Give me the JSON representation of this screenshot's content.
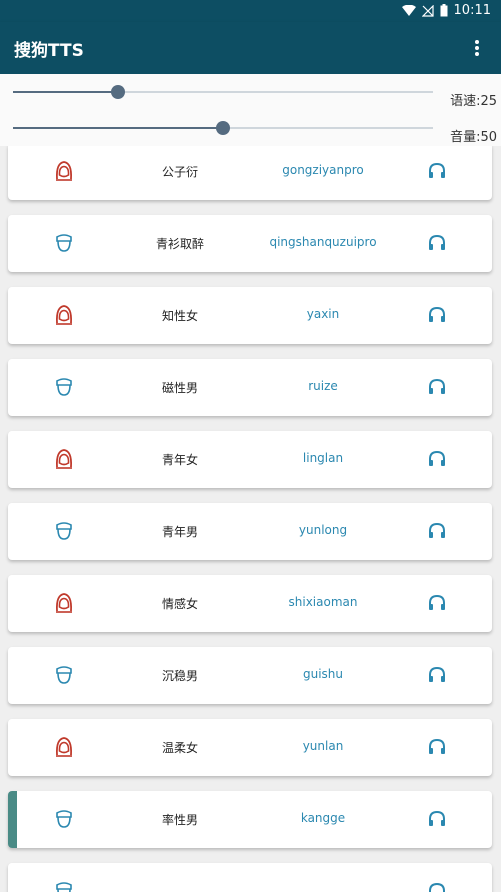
{
  "status": {
    "time": "10:11",
    "battery": "B"
  },
  "app": {
    "title": "搜狗TTS"
  },
  "speed": {
    "label": "语速:25",
    "value": 25
  },
  "volume": {
    "label": "音量:50",
    "value": 50
  },
  "voices": [
    {
      "name": "公子衍",
      "code": "gongziyanpro",
      "gender": "female"
    },
    {
      "name": "青衫取醉",
      "code": "qingshanquzuipro",
      "gender": "male"
    },
    {
      "name": "知性女",
      "code": "yaxin",
      "gender": "female"
    },
    {
      "name": "磁性男",
      "code": "ruize",
      "gender": "male"
    },
    {
      "name": "青年女",
      "code": "linglan",
      "gender": "female"
    },
    {
      "name": "青年男",
      "code": "yunlong",
      "gender": "male"
    },
    {
      "name": "情感女",
      "code": "shixiaoman",
      "gender": "female"
    },
    {
      "name": "沉稳男",
      "code": "guishu",
      "gender": "male"
    },
    {
      "name": "温柔女",
      "code": "yunlan",
      "gender": "female"
    },
    {
      "name": "率性男",
      "code": "kangge",
      "gender": "male",
      "selected": true
    },
    {
      "name": "",
      "code": "",
      "gender": "male"
    }
  ],
  "colors": {
    "female": "#c0392b",
    "male": "#2b88b0",
    "headphone": "#2b88b0",
    "appbar": "#0d4e63",
    "accent": "#4a8b86"
  }
}
